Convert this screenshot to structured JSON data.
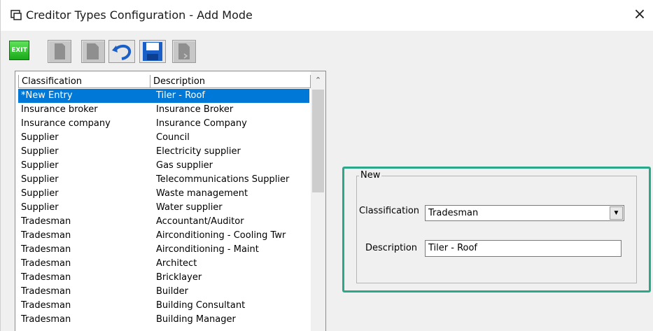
{
  "window": {
    "title": "Creditor Types Configuration - Add Mode",
    "close_glyph": "×"
  },
  "toolbar": {
    "exit_label": "EXIT",
    "buttons": [
      "new-icon",
      "copy-icon",
      "undo-icon",
      "save-icon",
      "delete-icon"
    ],
    "colors": {
      "exit": "#22b522",
      "undo": "#1a5fc8",
      "save": "#1a5fc8",
      "disabled": "#c7c7c7"
    }
  },
  "grid": {
    "columns": [
      "Classification",
      "Description"
    ],
    "rows": [
      {
        "classification": "*New Entry",
        "description": "Tiler - Roof"
      },
      {
        "classification": "Insurance broker",
        "description": "Insurance Broker"
      },
      {
        "classification": "Insurance company",
        "description": "Insurance Company"
      },
      {
        "classification": "Supplier",
        "description": "Council"
      },
      {
        "classification": "Supplier",
        "description": "Electricity supplier"
      },
      {
        "classification": "Supplier",
        "description": "Gas supplier"
      },
      {
        "classification": "Supplier",
        "description": "Telecommunications Supplier"
      },
      {
        "classification": "Supplier",
        "description": "Waste management"
      },
      {
        "classification": "Supplier",
        "description": "Water supplier"
      },
      {
        "classification": "Tradesman",
        "description": "Accountant/Auditor"
      },
      {
        "classification": "Tradesman",
        "description": "Airconditioning - Cooling Twr"
      },
      {
        "classification": "Tradesman",
        "description": "Airconditioning - Maint"
      },
      {
        "classification": "Tradesman",
        "description": "Architect"
      },
      {
        "classification": "Tradesman",
        "description": "Bricklayer"
      },
      {
        "classification": "Tradesman",
        "description": "Builder"
      },
      {
        "classification": "Tradesman",
        "description": "Building Consultant"
      },
      {
        "classification": "Tradesman",
        "description": "Building Manager"
      }
    ],
    "selected_index": 0,
    "selection_color": "#0078d7"
  },
  "form": {
    "group_label": "New",
    "classification_label": "Classification",
    "classification_value": "Tradesman",
    "description_label": "Description",
    "description_value": "Tiler - Roof",
    "highlight_color": "#2aa889"
  }
}
